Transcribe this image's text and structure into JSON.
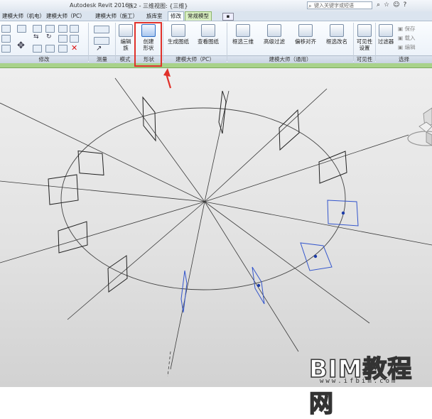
{
  "titlebar": {
    "app": "Autodesk Revit 2016 -",
    "document": "族2 - 三维视图: {三维}",
    "search_placeholder": "键入关键字或短语"
  },
  "tabs": [
    {
      "label": "建模大师（机电）"
    },
    {
      "label": "建模大师（PC）"
    },
    {
      "label": "建模大师（施工）"
    },
    {
      "label": "族库室"
    },
    {
      "label": "修改"
    },
    {
      "label": "常规模型"
    }
  ],
  "ribbon": {
    "buttons": {
      "edit_family": "编辑\n族",
      "create_shape": "创建\n形状",
      "gen_drawing": "生成图纸",
      "view_drawing": "查看图纸",
      "box_3d": "框选三维",
      "adv_filter": "高级过滤",
      "offset_align": "偏移对齐",
      "rename": "框选改名",
      "visibility": "可见性\n设置",
      "filter": "过滤器",
      "save": "保存",
      "load": "载入",
      "edit": "编辑"
    },
    "panels": {
      "modify": "修改",
      "measure": "测量",
      "mode": "模式",
      "shape": "形状",
      "pc": "建模大师（PC）",
      "general": "建模大师（通用）",
      "visibility": "可见性",
      "select": "选择"
    }
  },
  "colors": {
    "highlight": "#e0312a",
    "selected_profile": "#3355cc",
    "line": "#333333"
  },
  "watermark": {
    "text": "BIM教程网",
    "url": "www.ifbim.com"
  }
}
